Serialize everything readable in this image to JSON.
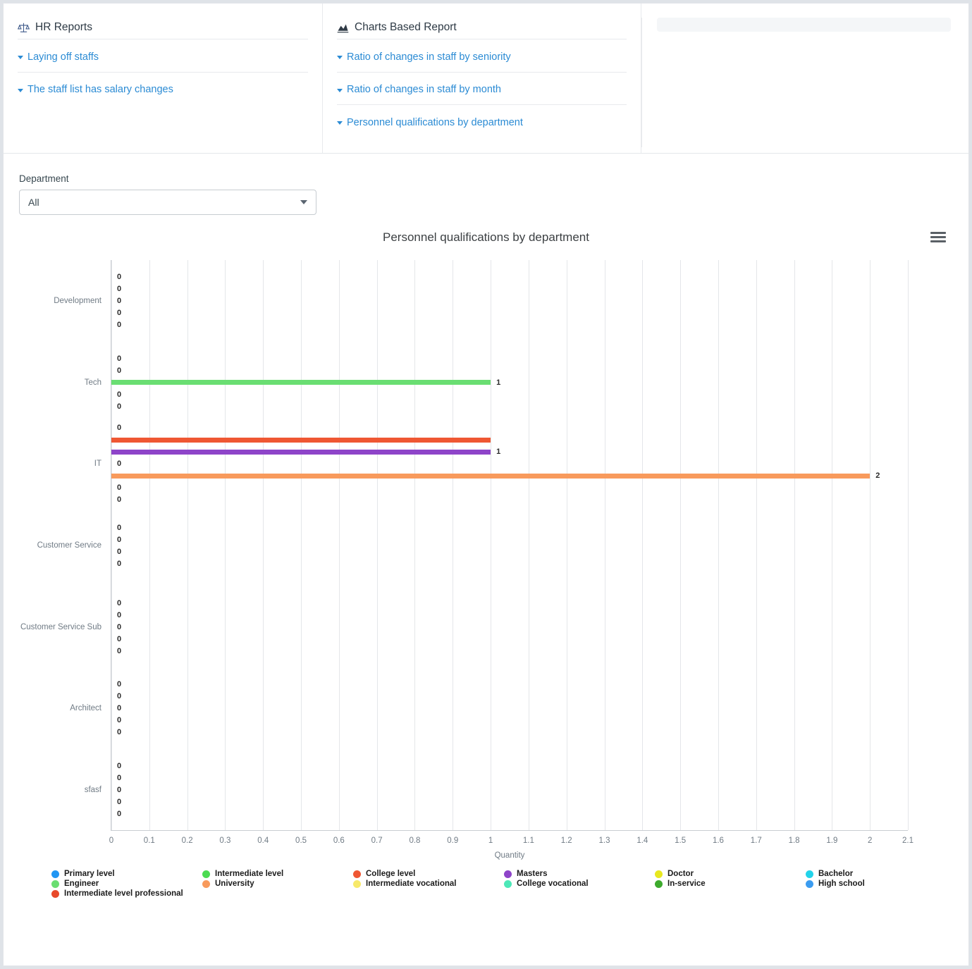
{
  "panels": [
    {
      "title": "HR Reports",
      "icon": "scales-icon",
      "links": [
        "Laying off staffs",
        "The staff list has salary changes"
      ]
    },
    {
      "title": "Charts Based Report",
      "icon": "area-chart-icon",
      "links": [
        "Ratio of changes in staff by seniority",
        "Ratio of changes in staff by month",
        "Personnel qualifications by department"
      ]
    }
  ],
  "filter": {
    "label": "Department",
    "value": "All"
  },
  "chart_menu_icon": "hamburger-menu-icon",
  "chart_data": {
    "type": "bar",
    "orientation": "horizontal",
    "title": "Personnel qualifications by department",
    "xlabel": "Quantity",
    "ylabel": "",
    "xlim": [
      0,
      2.1
    ],
    "xticks": [
      "0",
      "0.1",
      "0.2",
      "0.3",
      "0.4",
      "0.5",
      "0.6",
      "0.7",
      "0.8",
      "0.9",
      "1",
      "1.1",
      "1.2",
      "1.3",
      "1.4",
      "1.5",
      "1.6",
      "1.7",
      "1.8",
      "1.9",
      "2",
      "2.1"
    ],
    "grid": true,
    "legend_position": "bottom",
    "categories": [
      "Development",
      "Tech",
      "IT",
      "Customer Service",
      "Customer Service Sub",
      "Architect",
      "sfasf"
    ],
    "series": [
      {
        "name": "Primary level",
        "color": "#2196f3",
        "values": [
          0,
          0,
          0,
          0,
          0,
          0,
          0
        ]
      },
      {
        "name": "Intermediate level",
        "color": "#4cdb52",
        "values": [
          0,
          0,
          0,
          0,
          0,
          0,
          0
        ]
      },
      {
        "name": "College level",
        "color": "#ef5733",
        "values": [
          0,
          0,
          0,
          0,
          0,
          0,
          0
        ]
      },
      {
        "name": "Masters",
        "color": "#8e44c9",
        "values": [
          0,
          0,
          0,
          0,
          0,
          0,
          0
        ]
      },
      {
        "name": "Doctor",
        "color": "#e8e81f",
        "values": [
          0,
          0,
          0,
          0,
          0,
          0,
          0
        ]
      },
      {
        "name": "Bachelor",
        "color": "#22d3ea",
        "values": [
          0,
          0,
          0,
          0,
          0,
          0,
          0
        ]
      },
      {
        "name": "Engineer",
        "color": "#6ade72",
        "values": [
          0,
          0,
          0,
          0,
          0,
          0,
          0
        ]
      },
      {
        "name": "University",
        "color": "#f89a5c",
        "values": [
          0,
          0,
          0,
          0,
          0,
          0,
          0
        ]
      },
      {
        "name": "Intermediate vocational",
        "color": "#f7e96a",
        "values": [
          0,
          0,
          0,
          0,
          0,
          0,
          0
        ]
      },
      {
        "name": "College vocational",
        "color": "#4de8b8",
        "values": [
          0,
          0,
          0,
          0,
          0,
          0,
          0
        ]
      },
      {
        "name": "In-service",
        "color": "#3daa2d",
        "values": [
          0,
          0,
          0,
          0,
          0,
          0,
          0
        ]
      },
      {
        "name": "High school",
        "color": "#3b9cf0",
        "values": [
          0,
          0,
          0,
          0,
          0,
          0,
          0
        ]
      },
      {
        "name": "Intermediate level professional",
        "color": "#e8492a",
        "values": [
          0,
          0,
          0,
          0,
          0,
          0,
          0
        ]
      }
    ],
    "visible_bars": [
      {
        "category": "Development",
        "row": 0,
        "labels": [
          "0",
          "0",
          "0",
          "0",
          "0"
        ],
        "bars": []
      },
      {
        "category": "Tech",
        "row": 1,
        "labels": [
          "0",
          "0",
          "0",
          "0"
        ],
        "bars": [
          {
            "name": "Intermediate level",
            "color": "#6ade72",
            "value": 1,
            "label": "1"
          }
        ]
      },
      {
        "category": "IT",
        "row": 2,
        "labels": [
          "0",
          "0",
          "0",
          "0"
        ],
        "bars": [
          {
            "name": "College level",
            "color": "#ef5733",
            "value": 1,
            "label": ""
          },
          {
            "name": "Masters",
            "color": "#8e44c9",
            "value": 1,
            "label": "1"
          },
          {
            "name": "University",
            "color": "#f89a5c",
            "value": 2,
            "label": "2"
          }
        ]
      },
      {
        "category": "Customer Service",
        "row": 3,
        "labels": [
          "0",
          "0",
          "0",
          "0"
        ],
        "bars": []
      },
      {
        "category": "Customer Service Sub",
        "row": 4,
        "labels": [
          "0",
          "0",
          "0",
          "0",
          "0"
        ],
        "bars": []
      },
      {
        "category": "Architect",
        "row": 5,
        "labels": [
          "0",
          "0",
          "0",
          "0",
          "0"
        ],
        "bars": []
      },
      {
        "category": "sfasf",
        "row": 6,
        "labels": [
          "0",
          "0",
          "0",
          "0",
          "0"
        ],
        "bars": []
      }
    ]
  },
  "legend_columns": [
    [
      {
        "label": "Primary level",
        "color": "#2196f3"
      },
      {
        "label": "Engineer",
        "color": "#6ade72"
      },
      {
        "label": "Intermediate level professional",
        "color": "#e8492a"
      }
    ],
    [
      {
        "label": "Intermediate level",
        "color": "#4cdb52"
      },
      {
        "label": "University",
        "color": "#f89a5c"
      }
    ],
    [
      {
        "label": "College level",
        "color": "#ef5733"
      },
      {
        "label": "Intermediate vocational",
        "color": "#f7e96a"
      }
    ],
    [
      {
        "label": "Masters",
        "color": "#8e44c9"
      },
      {
        "label": "College vocational",
        "color": "#4de8b8"
      }
    ],
    [
      {
        "label": "Doctor",
        "color": "#e8e81f"
      },
      {
        "label": "In-service",
        "color": "#3daa2d"
      }
    ],
    [
      {
        "label": "Bachelor",
        "color": "#22d3ea"
      },
      {
        "label": "High school",
        "color": "#3b9cf0"
      }
    ]
  ]
}
